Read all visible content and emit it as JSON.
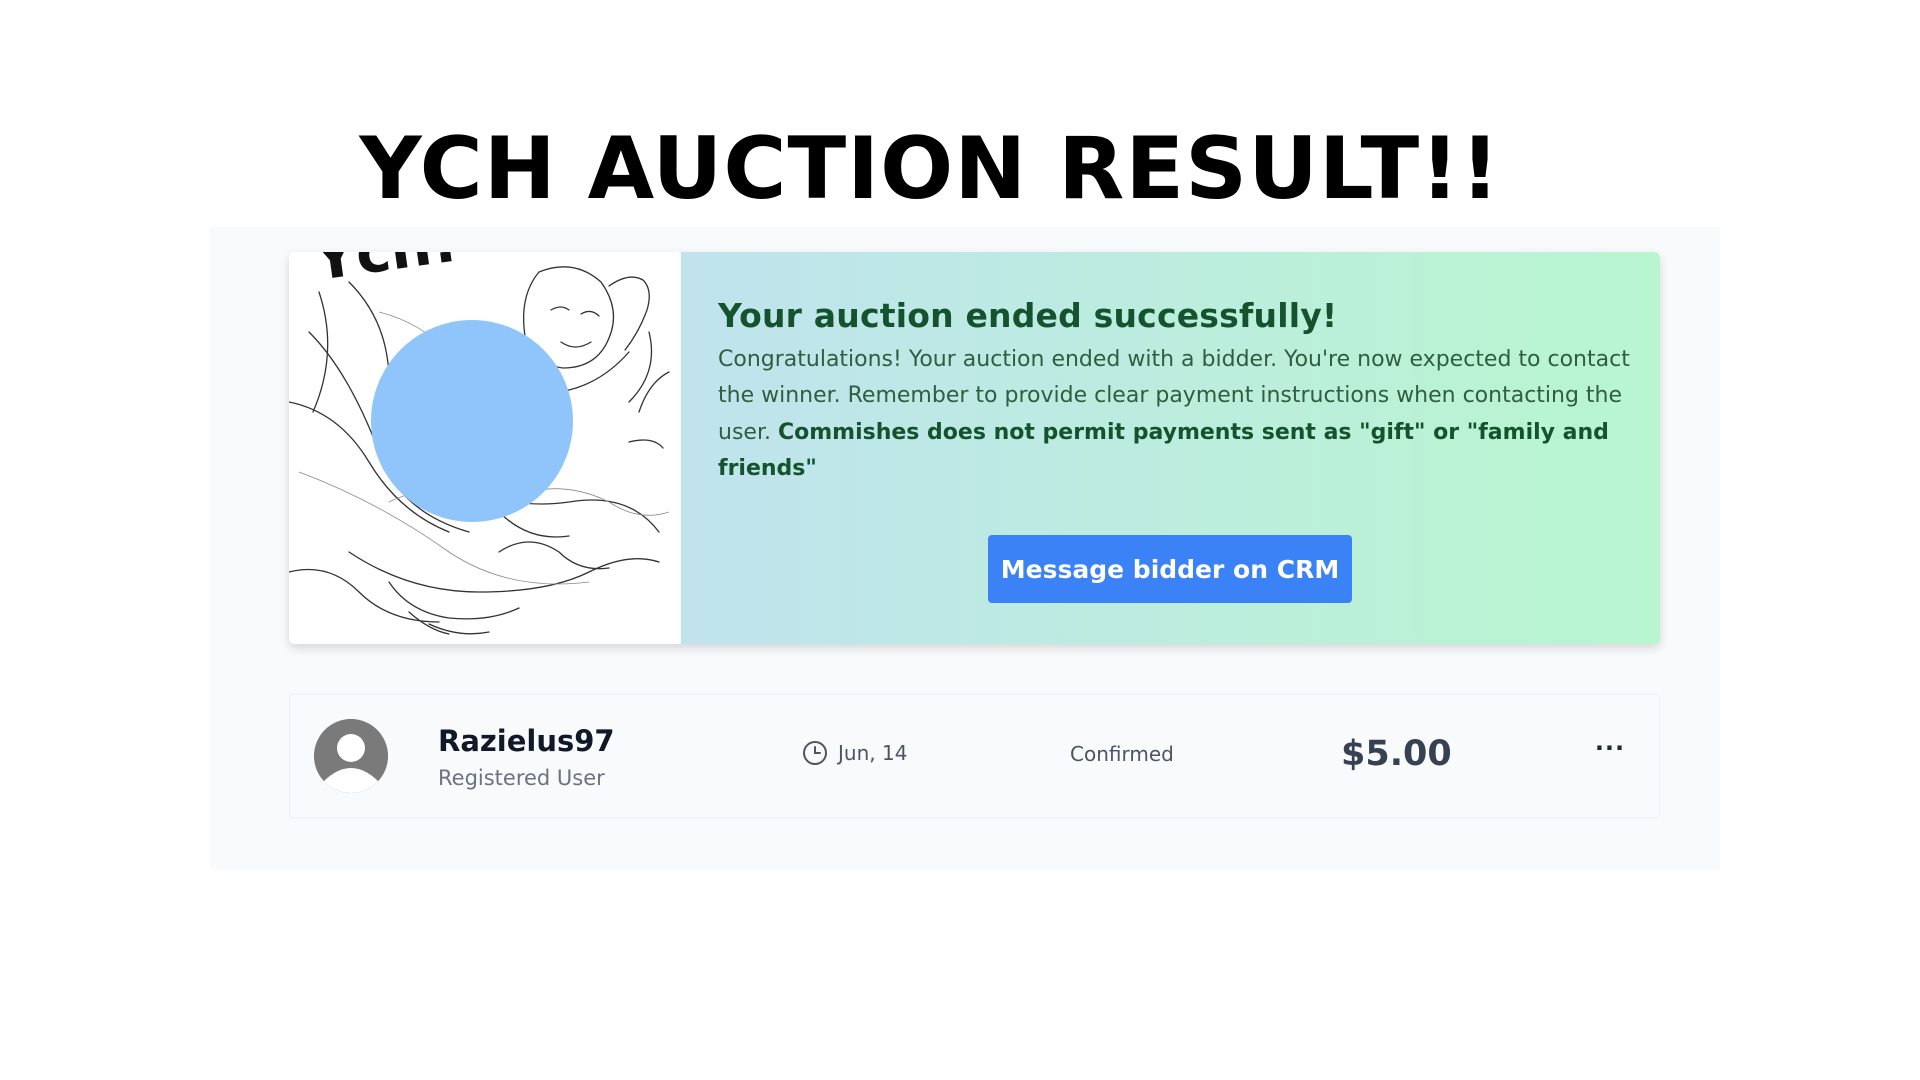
{
  "headline": "YCH AUCTION RESULT!!",
  "result_card": {
    "title": "Your auction ended successfully!",
    "message": "Congratulations! Your auction ended with a bidder. You're now expected to contact the winner. Remember to provide clear payment instructions when contacting the user.",
    "message_bold": "Commishes does not permit payments sent as \"gift\" or \"family and friends\"",
    "button_label": "Message bidder on CRM",
    "thumbnail_text": "Ych!"
  },
  "bid": {
    "bidder_name": "Razielus97",
    "bidder_role": "Registered User",
    "date": "Jun, 14",
    "status": "Confirmed",
    "amount": "$5.00",
    "more_label": "···"
  },
  "icons": {
    "date": "clock-icon",
    "avatar": "user-avatar-icon",
    "more": "more-options-icon"
  },
  "colors": {
    "title": "#14532d",
    "button": "#3b82f6",
    "censor_dot": "#90c5fb",
    "gradient_start": "#c0e3ee",
    "gradient_end": "#b8f6cf"
  }
}
